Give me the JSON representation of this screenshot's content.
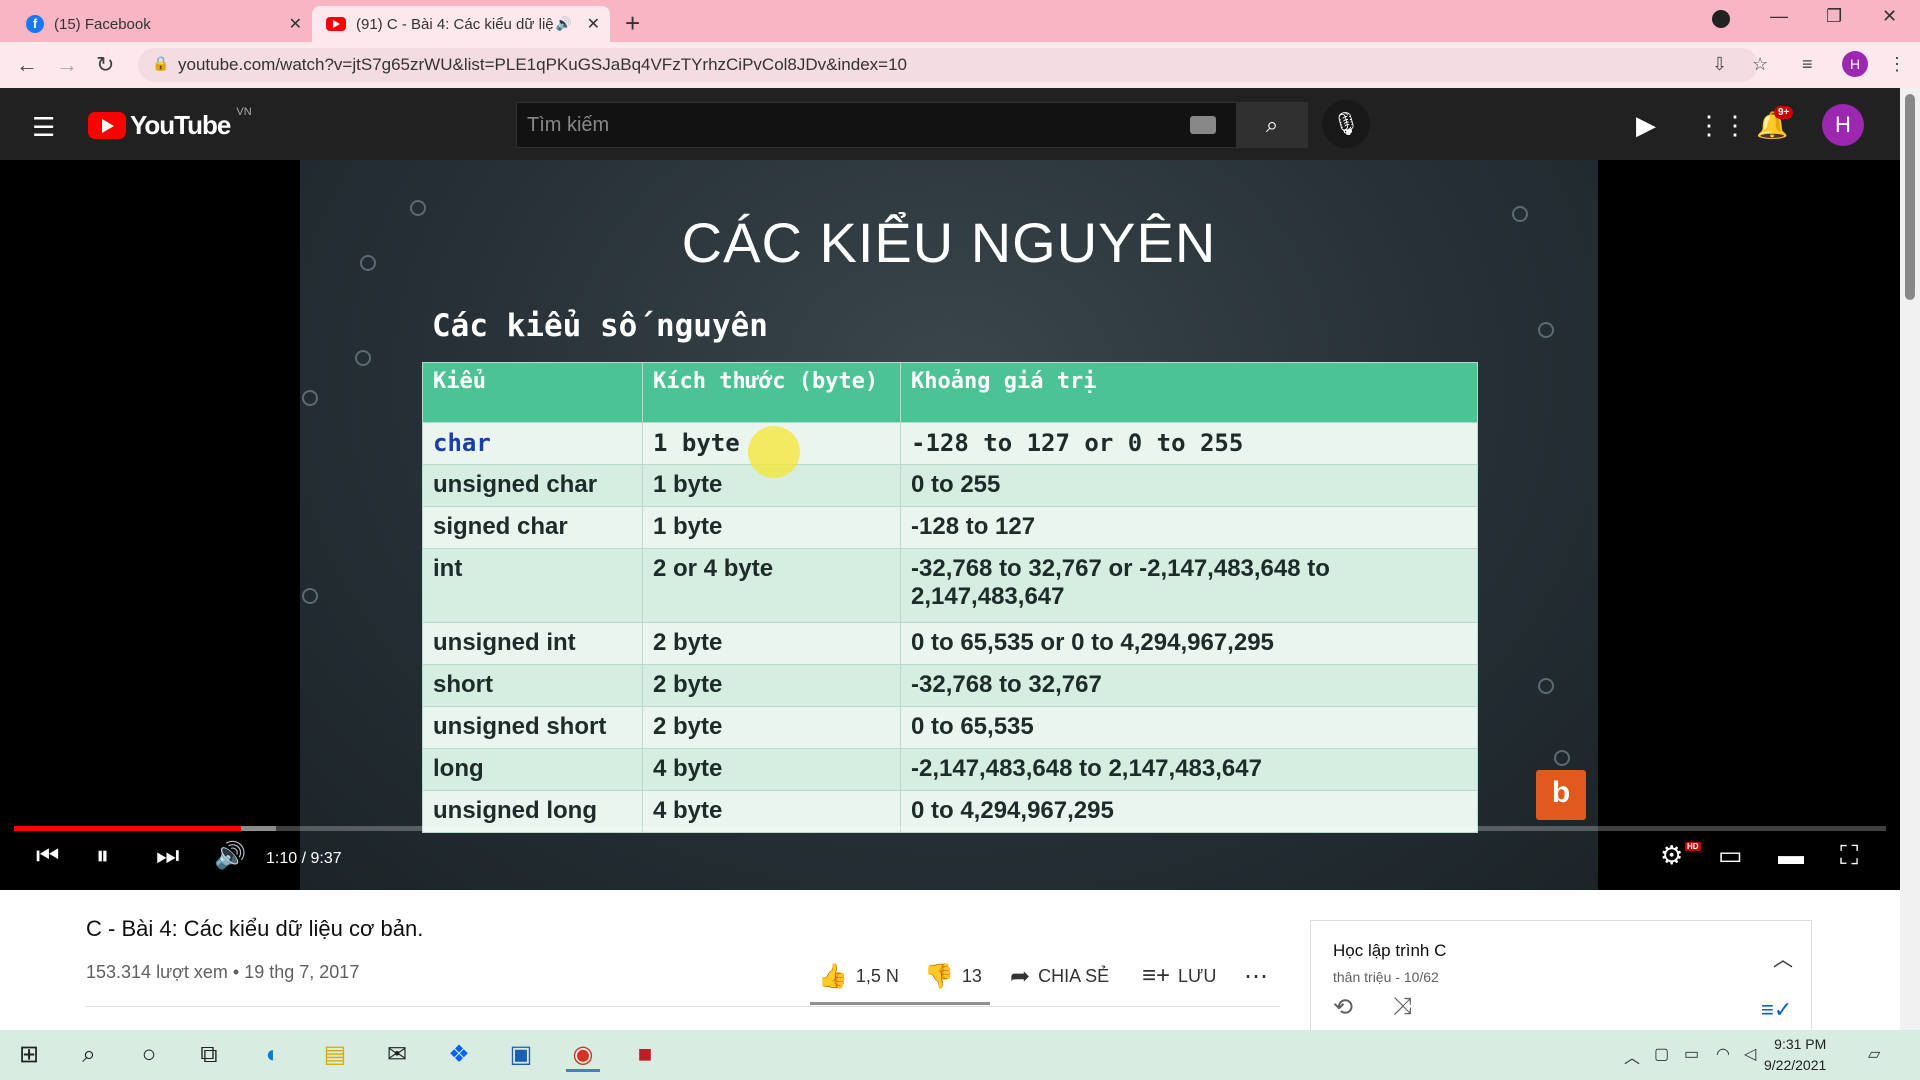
{
  "browser": {
    "tabs": [
      {
        "title": "(15) Facebook",
        "icon": "facebook-icon"
      },
      {
        "title": "(91) C - Bài 4: Các kiểu dữ liệ",
        "icon": "youtube-icon",
        "active": true
      }
    ],
    "url": "youtube.com/watch?v=jtS7g65zrWU&list=PLE1qPKuGSJaBq4VFzTYrhzCiPvCol8JDv&index=10",
    "profile_initial": "H"
  },
  "youtube": {
    "logo_text": "YouTube",
    "country_code": "VN",
    "search_placeholder": "Tìm kiếm",
    "notification_count": "9+",
    "avatar_initial": "H"
  },
  "slide": {
    "title": "CÁC KIỂU NGUYÊN",
    "subtitle": "Các kiểu số nguyên",
    "headers": [
      "Kiểu",
      "Kích thước (byte)",
      "Khoảng giá trị"
    ],
    "rows": [
      {
        "type": "char",
        "size": "1 byte",
        "range": "-128 to 127 or 0 to 255"
      },
      {
        "type": "unsigned char",
        "size": "1 byte",
        "range": "0 to 255"
      },
      {
        "type": "signed char",
        "size": "1 byte",
        "range": "-128 to 127"
      },
      {
        "type": "int",
        "size": "2 or 4 byte",
        "range": "-32,768 to 32,767 or -2,147,483,648 to 2,147,483,647"
      },
      {
        "type": "unsigned int",
        "size": "2 byte",
        "range": "0 to 65,535 or 0 to 4,294,967,295"
      },
      {
        "type": "short",
        "size": "2 byte",
        "range": "-32,768 to 32,767"
      },
      {
        "type": "unsigned short",
        "size": "2 byte",
        "range": "0 to 65,535"
      },
      {
        "type": "long",
        "size": "4 byte",
        "range": "-2,147,483,648 to 2,147,483,647"
      },
      {
        "type": "unsigned long",
        "size": "4 byte",
        "range": "0 to 4,294,967,295"
      }
    ]
  },
  "player": {
    "time": "1:10 / 9:37",
    "progress_played_fraction": 0.1212,
    "progress_loaded_fraction": 0.14,
    "hd_badge": "HD"
  },
  "video": {
    "title": "C - Bài 4: Các kiểu dữ liệu cơ bản.",
    "meta": "153.314 lượt xem • 19 thg 7, 2017",
    "likes": "1,5 N",
    "dislikes": "13",
    "share_label": "CHIA SẺ",
    "save_label": "LƯU"
  },
  "playlist": {
    "title": "Học lập trình C",
    "subtitle": "thân triệu - 10/62"
  },
  "taskbar": {
    "time": "9:31 PM",
    "date": "9/22/2021"
  },
  "colors": {
    "tab_bar": "#f8b6c4",
    "youtube_red": "#ff0000",
    "table_header": "#4cc394"
  }
}
